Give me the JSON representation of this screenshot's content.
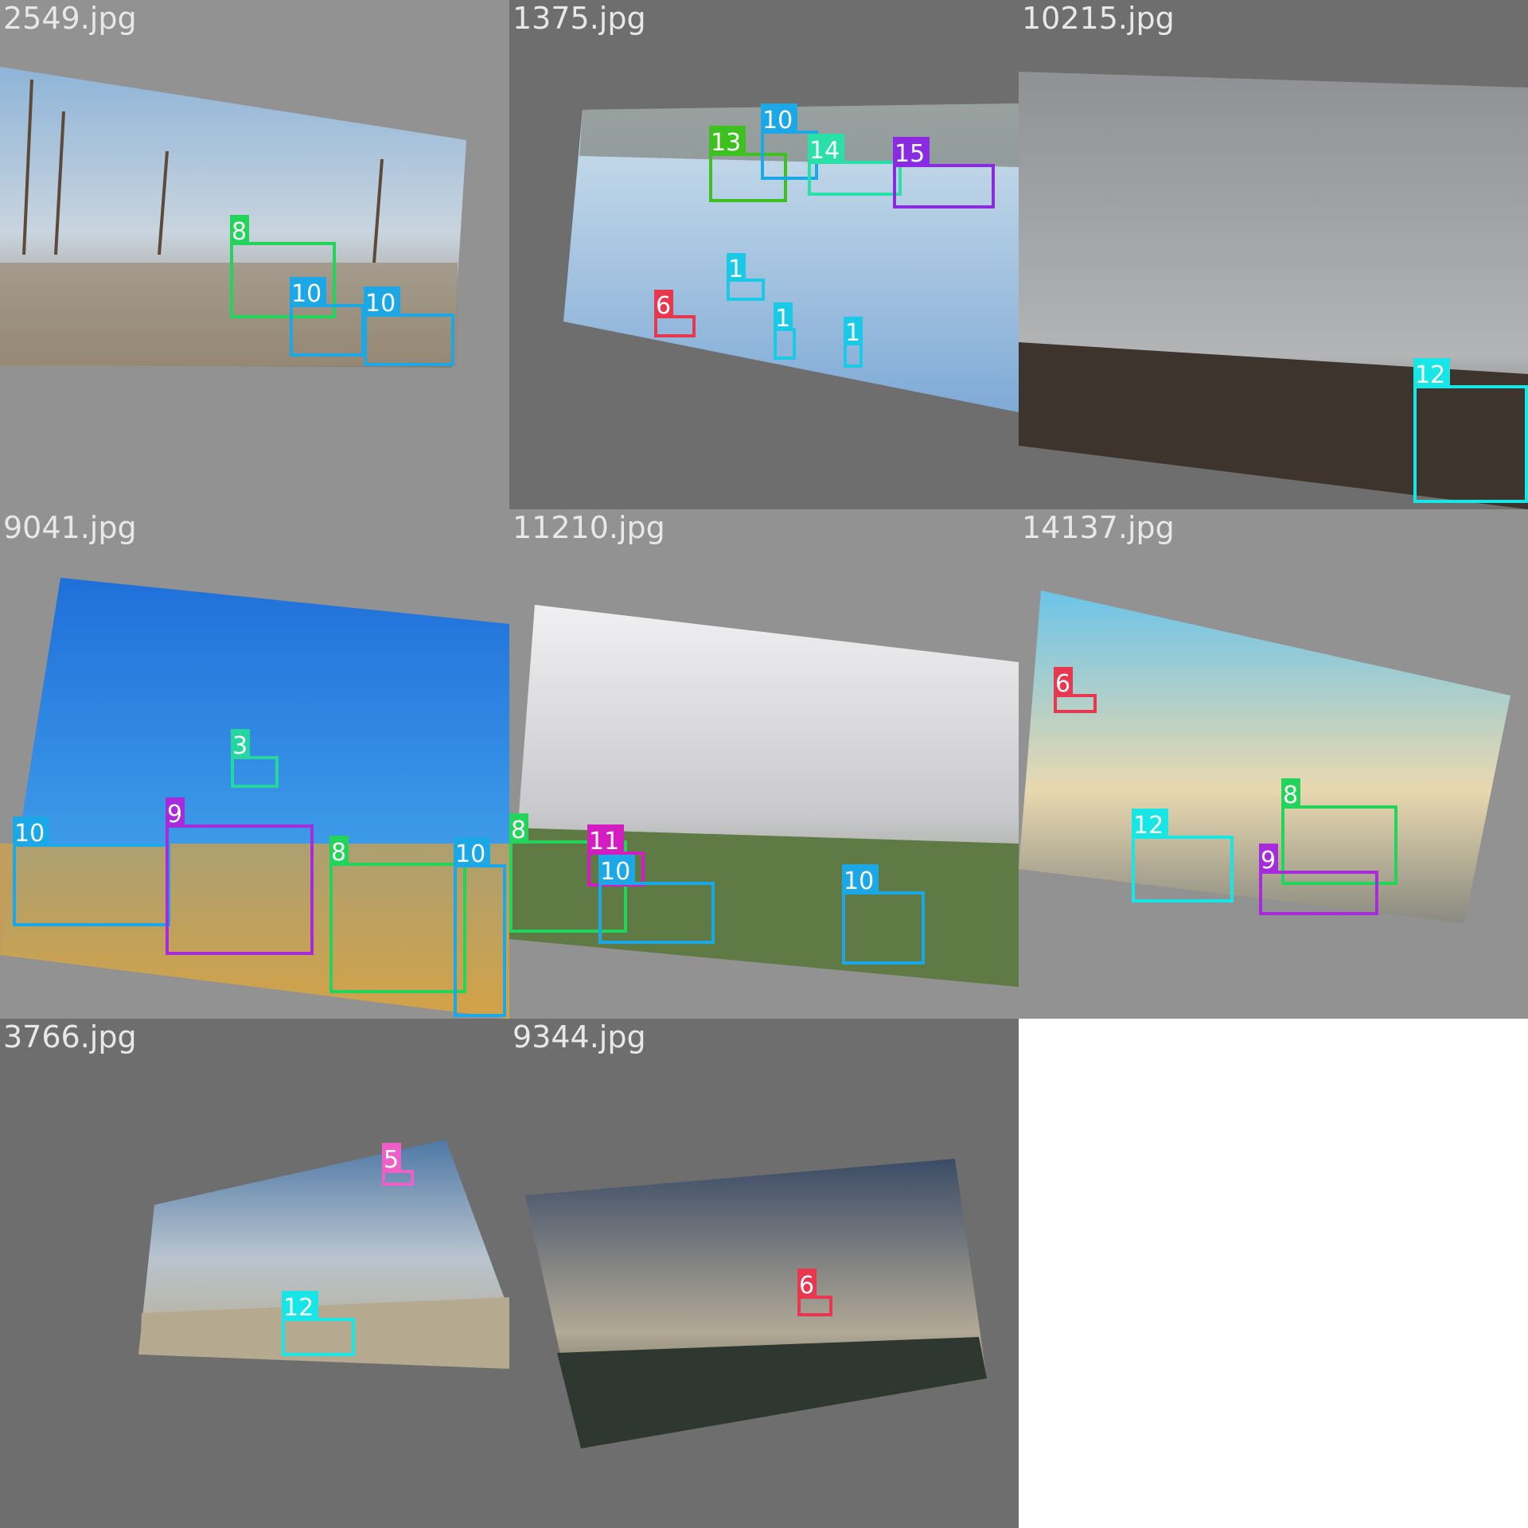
{
  "colors": {
    "1": "#19c9e6",
    "3": "#25d6a0",
    "5": "#ee5fc7",
    "6": "#e8384f",
    "8": "#22d45a",
    "9": "#a52bdb",
    "10": "#1ca8e6",
    "11": "#d41dc1",
    "12": "#18e6e6",
    "13": "#3dc11f",
    "14": "#28e0a8",
    "15": "#8a2be2"
  },
  "tiles": [
    {
      "filename": "2549.jpg",
      "labels": [
        "8",
        "10",
        "10"
      ]
    },
    {
      "filename": "1375.jpg",
      "labels": [
        "13",
        "10",
        "14",
        "15",
        "1",
        "6",
        "1",
        "1"
      ]
    },
    {
      "filename": "10215.jpg",
      "labels": [
        "12"
      ]
    },
    {
      "filename": "9041.jpg",
      "labels": [
        "3",
        "10",
        "9",
        "8",
        "10"
      ]
    },
    {
      "filename": "11210.jpg",
      "labels": [
        "8",
        "11",
        "10",
        "10"
      ]
    },
    {
      "filename": "14137.jpg",
      "labels": [
        "6",
        "12",
        "8",
        "9"
      ]
    },
    {
      "filename": "3766.jpg",
      "labels": [
        "5",
        "12"
      ]
    },
    {
      "filename": "9344.jpg",
      "labels": [
        "6"
      ]
    }
  ]
}
